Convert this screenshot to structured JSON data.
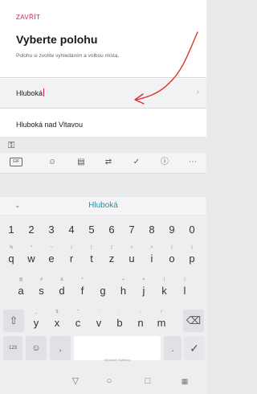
{
  "sheet": {
    "close_label": "ZAVŘÍT",
    "title": "Vyberte polohu",
    "subtitle": "Polohu si zvolíte vyhledáním a volbou místa.",
    "search_value": "Hluboká",
    "result": "Hluboká nad Vltavou"
  },
  "keyboard": {
    "suggestion": "Hluboká",
    "numbers": [
      "1",
      "2",
      "3",
      "4",
      "5",
      "6",
      "7",
      "8",
      "9",
      "0"
    ],
    "row1": [
      {
        "sup": "%",
        "main": "q"
      },
      {
        "sup": "^",
        "main": "w"
      },
      {
        "sup": "~",
        "main": "e"
      },
      {
        "sup": "|",
        "main": "r"
      },
      {
        "sup": "[",
        "main": "t"
      },
      {
        "sup": "]",
        "main": "z"
      },
      {
        "sup": "<",
        "main": "u"
      },
      {
        "sup": ">",
        "main": "i"
      },
      {
        "sup": "{",
        "main": "o"
      },
      {
        "sup": "}",
        "main": "p"
      }
    ],
    "row2": [
      {
        "sup": "@",
        "main": "a"
      },
      {
        "sup": "#",
        "main": "s"
      },
      {
        "sup": "&",
        "main": "d"
      },
      {
        "sup": "*",
        "main": "f"
      },
      {
        "sup": "-",
        "main": "g"
      },
      {
        "sup": "+",
        "main": "h"
      },
      {
        "sup": "=",
        "main": "j"
      },
      {
        "sup": "(",
        "main": "k"
      },
      {
        "sup": ")",
        "main": "l"
      }
    ],
    "row3": [
      {
        "sup": "_",
        "main": "y"
      },
      {
        "sup": "$",
        "main": "x"
      },
      {
        "sup": "\"",
        "main": "c"
      },
      {
        "sup": "'",
        "main": "v"
      },
      {
        "sup": ":",
        "main": "b"
      },
      {
        "sup": ";",
        "main": "n"
      },
      {
        "sup": "/",
        "main": "m"
      }
    ],
    "fn_label": "123",
    "space_label": "Microsoft SwiftKey",
    "period": "."
  },
  "colors": {
    "accent": "#d1195e",
    "suggestion": "#2a92a6",
    "annotation": "#e0302a"
  },
  "icons": [
    "key-icon",
    "gif-icon",
    "sticker-icon",
    "clipboard-icon",
    "translate-icon",
    "checkmark-icon",
    "info-icon",
    "more-icon",
    "collapse-icon",
    "shift-icon",
    "backspace-icon",
    "emoji-icon",
    "comma-key",
    "enter-icon",
    "back-icon",
    "home-icon",
    "recents-icon",
    "keyboard-icon",
    "chevron-right-icon"
  ]
}
